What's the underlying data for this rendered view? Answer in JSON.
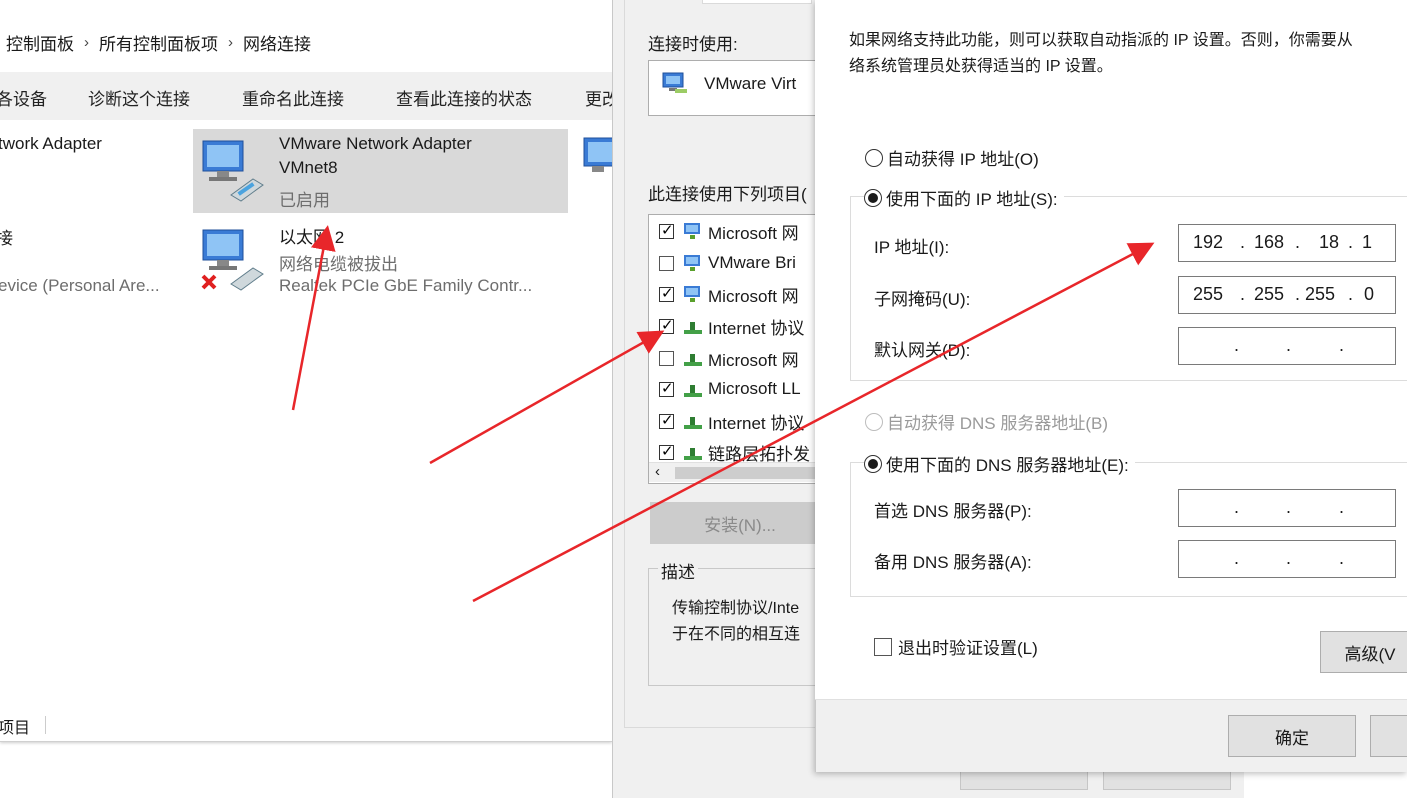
{
  "explorer": {
    "breadcrumb": [
      "控制面板",
      "所有控制面板项",
      "网络连接"
    ],
    "toolbar": [
      "各设备",
      "诊断这个连接",
      "重命名此连接",
      "查看此连接的状态",
      "更改"
    ],
    "adapters": [
      {
        "name": "twork Adapter",
        "status": "",
        "device": ""
      },
      {
        "name": "VMware Network Adapter VMnet8",
        "name_line1": "VMware Network Adapter",
        "name_line2": "VMnet8",
        "status": "已启用",
        "selected": true
      },
      {
        "name": "接",
        "status": "",
        "device": "evice (Personal Are..."
      },
      {
        "name": "以太网 2",
        "status": "网络电缆被拔出",
        "device": "Realtek PCIe GbE Family Contr...",
        "disconnected": true
      }
    ],
    "status_bar": "项目"
  },
  "properties": {
    "connect_using_label": "连接时使用:",
    "adapter_name": "VMware Virt",
    "items_label": "此连接使用下列项目(",
    "items": [
      {
        "label": "Microsoft 网",
        "checked": true,
        "icon": "network-client-icon"
      },
      {
        "label": "VMware Bri",
        "checked": false,
        "icon": "network-client-icon"
      },
      {
        "label": "Microsoft 网",
        "checked": true,
        "icon": "network-client-icon"
      },
      {
        "label": "Internet 协议",
        "checked": true,
        "icon": "protocol-icon"
      },
      {
        "label": "Microsoft 网",
        "checked": false,
        "icon": "protocol-icon"
      },
      {
        "label": "Microsoft LL",
        "checked": true,
        "icon": "protocol-icon"
      },
      {
        "label": "Internet 协议",
        "checked": true,
        "icon": "protocol-icon"
      },
      {
        "label": "链路层拓扑发",
        "checked": true,
        "icon": "protocol-icon"
      }
    ],
    "install_label": "安装(N)...",
    "description_title": "描述",
    "description_line1": "传输控制协议/Inte",
    "description_line2": "于在不同的相互连"
  },
  "ipv4": {
    "intro_line1": "如果网络支持此功能，则可以获取自动指派的 IP 设置。否则，你需要从",
    "intro_line2": "络系统管理员处获得适当的 IP 设置。",
    "auto_ip_label": "自动获得 IP 地址(O)",
    "manual_ip_label": "使用下面的 IP 地址(S):",
    "ip_label": "IP 地址(I):",
    "ip_octets": [
      "192",
      "168",
      "18",
      "1"
    ],
    "mask_label": "子网掩码(U):",
    "mask_octets": [
      "255",
      "255",
      "255",
      "0"
    ],
    "gateway_label": "默认网关(D):",
    "auto_dns_label": "自动获得 DNS 服务器地址(B)",
    "manual_dns_label": "使用下面的 DNS 服务器地址(E):",
    "dns1_label": "首选 DNS 服务器(P):",
    "dns2_label": "备用 DNS 服务器(A):",
    "validate_label": "退出时验证设置(L)",
    "advanced_label": "高级(V",
    "ok_label": "确定"
  },
  "colors": {
    "arrow": "#e8262a",
    "selection": "#d9d9d9",
    "dialog_bg": "#f0f0f0"
  }
}
